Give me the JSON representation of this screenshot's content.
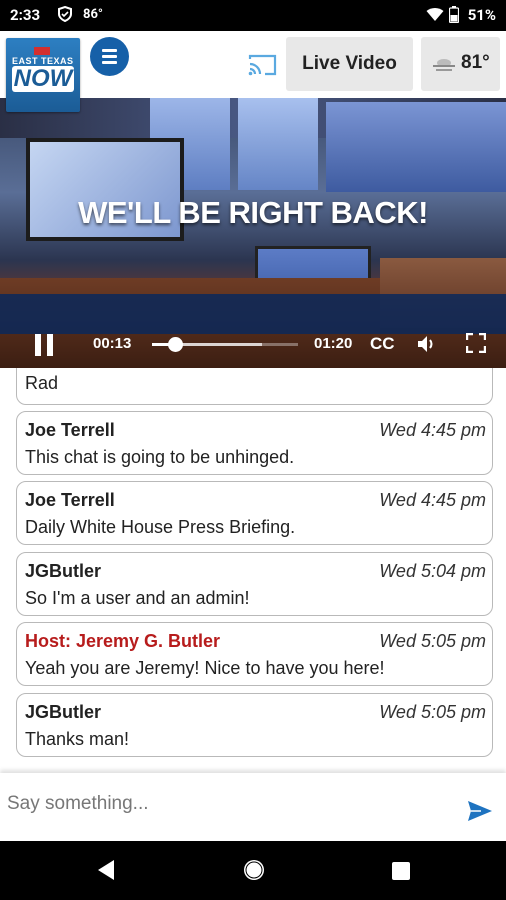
{
  "status_bar": {
    "time": "2:33",
    "temperature": "86°",
    "battery_percent": "51%"
  },
  "header": {
    "logo": {
      "line1": "EAST TEXAS",
      "line2": "NOW"
    },
    "live_label": "Live Video",
    "weather_temp": "81°"
  },
  "video": {
    "banner": "WE'LL BE RIGHT BACK!",
    "current_time": "00:13",
    "duration": "01:20",
    "cc_label": "CC",
    "progress_fraction": 0.16,
    "buffered_fraction": 0.75
  },
  "chat": {
    "partial_message": "Rad",
    "messages": [
      {
        "author": "Joe Terrell",
        "time": "Wed 4:45 pm",
        "text": "This chat is going to be unhinged.",
        "host": false
      },
      {
        "author": "Joe Terrell",
        "time": "Wed 4:45 pm",
        "text": "Daily White House Press Briefing.",
        "host": false
      },
      {
        "author": "JGButler",
        "time": "Wed 5:04 pm",
        "text": "So I'm a user and an admin!",
        "host": false
      },
      {
        "author": "Host: Jeremy G. Butler",
        "time": "Wed 5:05 pm",
        "text": "Yeah you are Jeremy! Nice to have you here!",
        "host": true
      },
      {
        "author": "JGButler",
        "time": "Wed 5:05 pm",
        "text": "Thanks man!",
        "host": false
      }
    ]
  },
  "input": {
    "placeholder": "Say something..."
  },
  "colors": {
    "accent": "#1660a8",
    "host": "#b71c1c"
  }
}
